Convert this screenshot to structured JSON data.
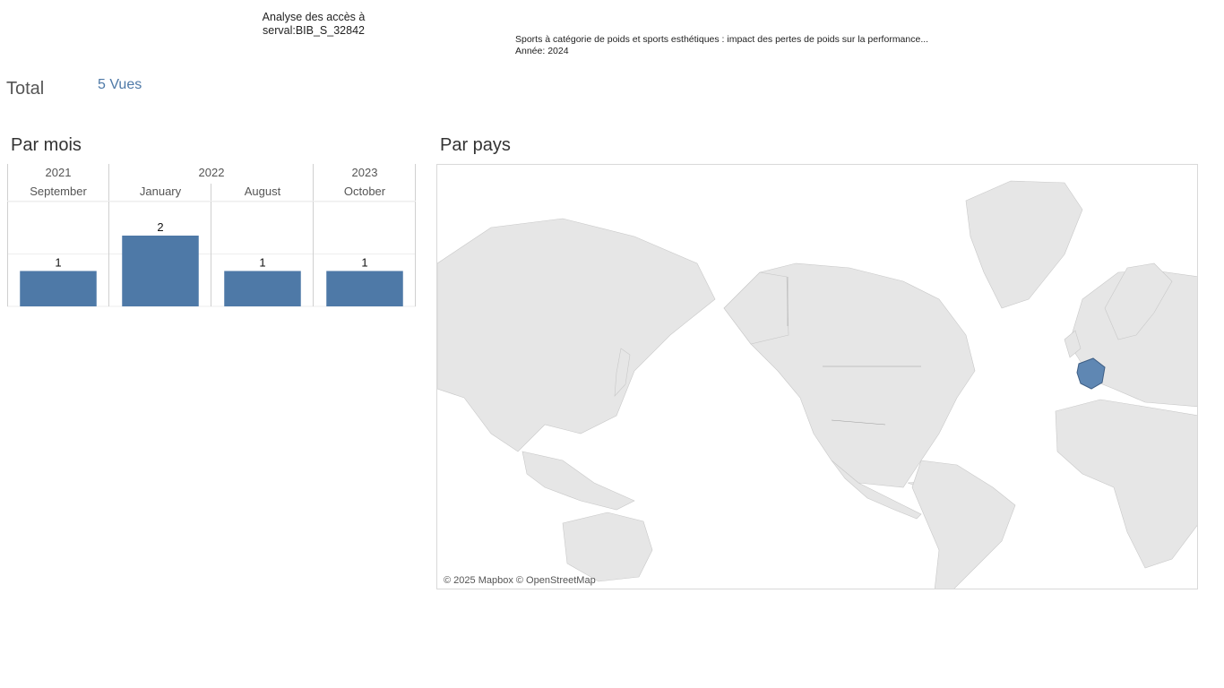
{
  "header": {
    "line1": "Analyse des accès à",
    "line2": "serval:BIB_S_32842"
  },
  "document": {
    "title": "Sports à catégorie de poids et sports esthétiques : impact des pertes de poids sur la performance...",
    "year_label": "Année: 2024"
  },
  "total": {
    "label": "Total",
    "value": "5 Vues"
  },
  "by_month": {
    "title": "Par mois"
  },
  "by_country": {
    "title": "Par pays",
    "attribution": "© 2025 Mapbox © OpenStreetMap",
    "highlighted_country": "France",
    "highlight_color": "#4e79a7"
  },
  "colors": {
    "bar": "#4e79a7",
    "land": "#e6e6e6",
    "border": "#9a9a9a"
  },
  "chart_data": {
    "type": "bar",
    "year_groups": [
      {
        "year": "2021",
        "months": [
          "September"
        ]
      },
      {
        "year": "2022",
        "months": [
          "January",
          "August"
        ]
      },
      {
        "year": "2023",
        "months": [
          "October"
        ]
      }
    ],
    "categories": [
      "September",
      "January",
      "August",
      "October"
    ],
    "values": [
      1,
      2,
      1,
      1
    ],
    "title": "Par mois",
    "xlabel": "",
    "ylabel": "",
    "ylim": [
      0,
      2
    ],
    "grid": true
  }
}
